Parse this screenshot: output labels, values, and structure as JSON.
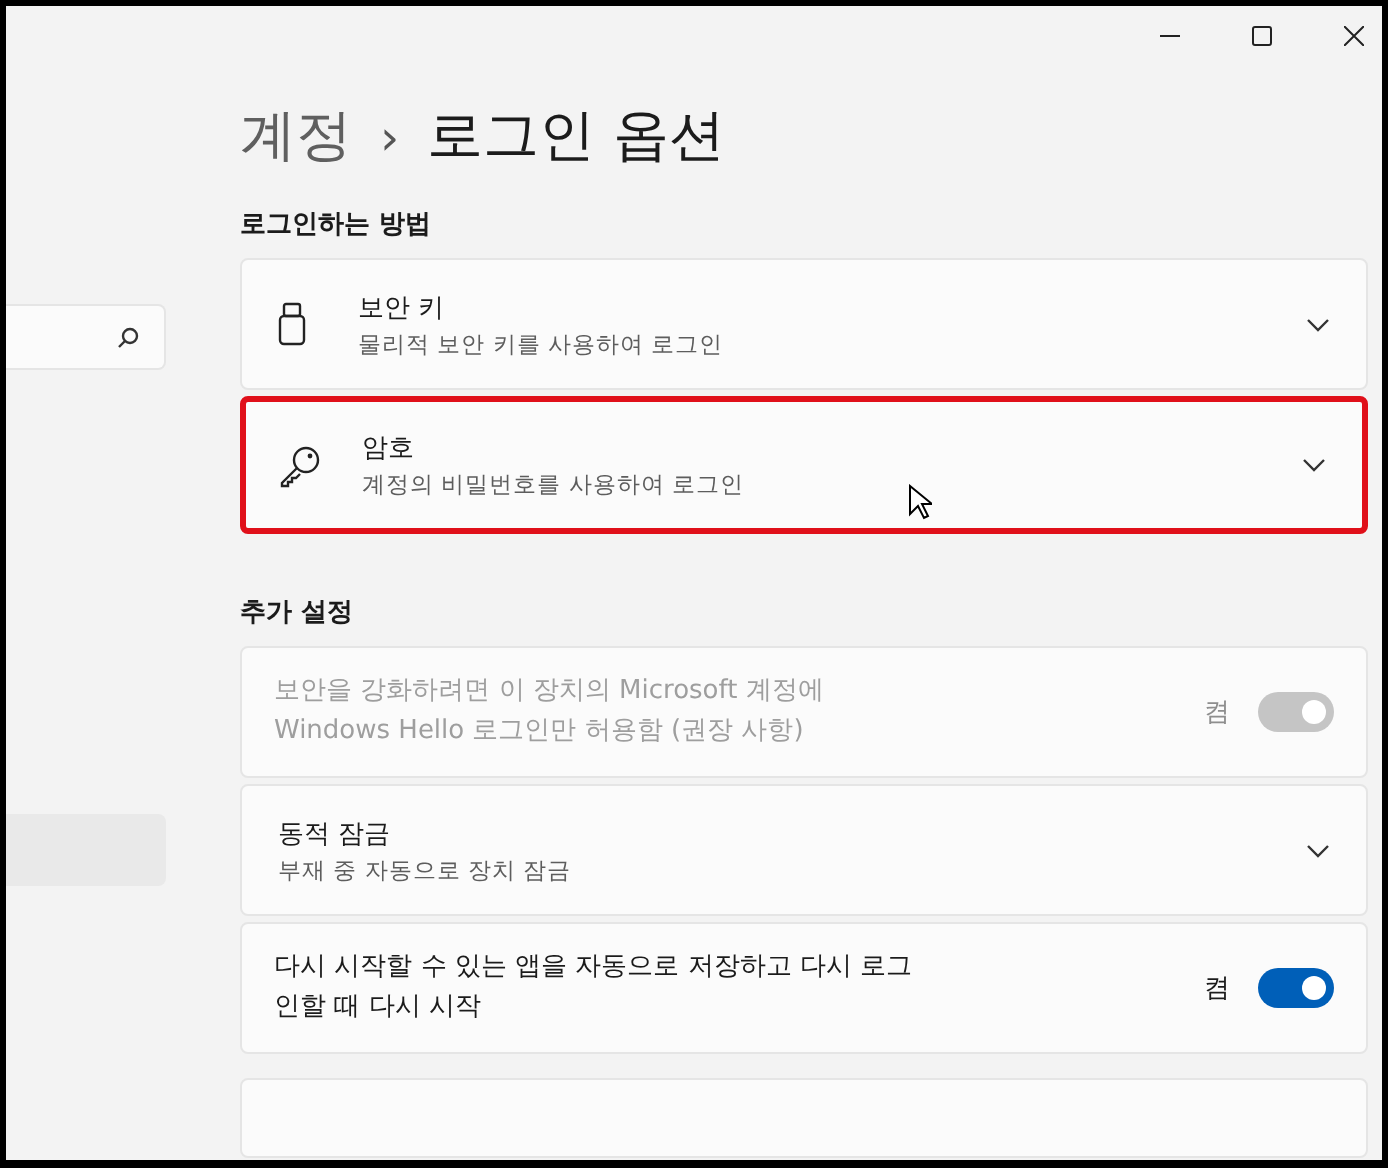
{
  "breadcrumb": {
    "parent": "계정",
    "separator": "›",
    "current": "로그인 옵션"
  },
  "sections": [
    {
      "heading": "로그인하는 방법",
      "cards": [
        {
          "kind": "usb-expander",
          "title": "보안 키",
          "subtitle": "물리적 보안 키를 사용하여 로그인",
          "highlighted": false
        },
        {
          "kind": "key-expander",
          "title": "암호",
          "subtitle": "계정의 비밀번호를 사용하여 로그인",
          "highlighted": true
        }
      ]
    },
    {
      "heading": "추가 설정",
      "cards": [
        {
          "kind": "toggle",
          "lines": [
            "보안을 강화하려면 이 장치의 Microsoft 계정에",
            "Windows Hello 로그인만 허용함 (권장 사항)"
          ],
          "state_label": "켬",
          "on": true,
          "disabled": true
        },
        {
          "kind": "expander",
          "title": "동적 잠금",
          "subtitle": "부재 중 자동으로 장치 잠금",
          "highlighted": false
        },
        {
          "kind": "toggle",
          "lines": [
            "다시 시작할 수 있는 앱을 자동으로 저장하고 다시 로그",
            "인할 때 다시 시작"
          ],
          "state_label": "켬",
          "on": true,
          "disabled": false
        },
        {
          "kind": "partial"
        }
      ]
    }
  ]
}
